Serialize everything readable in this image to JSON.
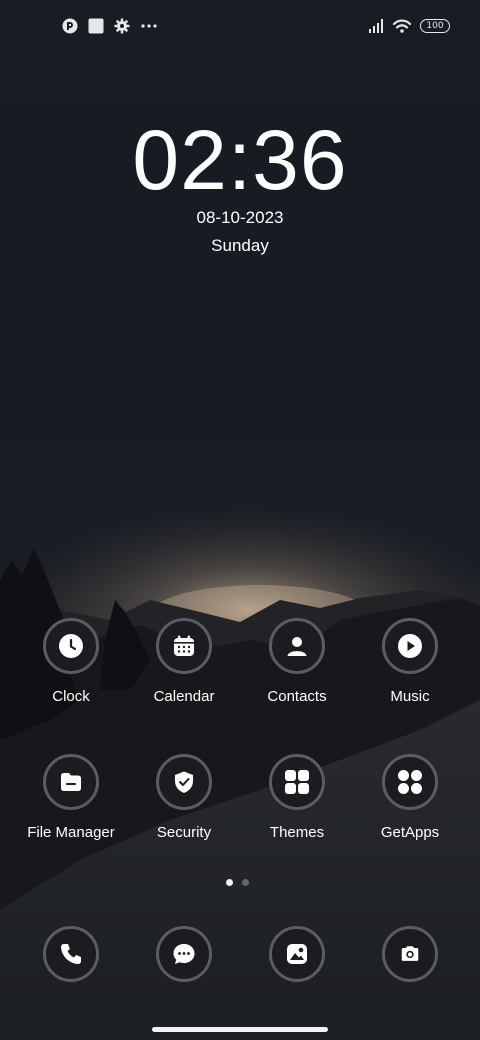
{
  "status_bar": {
    "left_icons": [
      "app-notification-icon",
      "square-notification-icon",
      "settings-gear-icon",
      "more-dots-icon"
    ],
    "right_icons": [
      "signal-icon",
      "wifi-icon"
    ],
    "battery_level": "100"
  },
  "lock": {
    "time": "02:36",
    "date": "08-10-2023",
    "day": "Sunday"
  },
  "apps": [
    {
      "label": "Clock",
      "icon": "clock-icon"
    },
    {
      "label": "Calendar",
      "icon": "calendar-icon"
    },
    {
      "label": "Contacts",
      "icon": "person-icon"
    },
    {
      "label": "Music",
      "icon": "play-icon"
    },
    {
      "label": "File Manager",
      "icon": "folder-icon"
    },
    {
      "label": "Security",
      "icon": "shield-icon"
    },
    {
      "label": "Themes",
      "icon": "grid-squares-icon"
    },
    {
      "label": "GetApps",
      "icon": "grid-circles-icon"
    }
  ],
  "dock": [
    {
      "icon": "phone-icon"
    },
    {
      "icon": "message-icon"
    },
    {
      "icon": "gallery-icon"
    },
    {
      "icon": "camera-icon"
    }
  ],
  "pager": {
    "pages": 2,
    "current": 1
  },
  "colors": {
    "icon_ring": "#5b5d63",
    "icon_fill": "#1b1c20",
    "glyph": "#ffffff"
  }
}
